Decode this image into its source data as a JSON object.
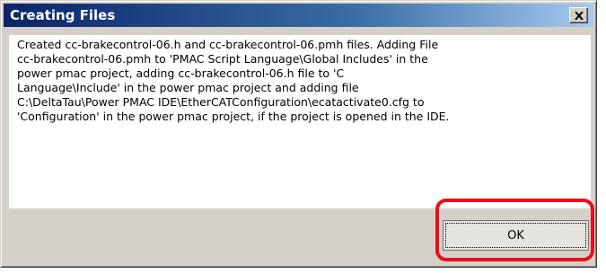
{
  "dialog": {
    "title": "Creating Files",
    "close_label": "X",
    "message_lines": [
      "Created cc-brakecontrol-06.h and cc-brakecontrol-06.pmh files. Adding File",
      "cc-brakecontrol-06.pmh to 'PMAC Script Language\\Global Includes' in the",
      "power pmac project, adding  cc-brakecontrol-06.h file to 'C",
      "Language\\Include' in the power pmac project and adding file",
      "C:\\DeltaTau\\Power PMAC IDE\\EtherCATConfiguration\\ecatactivate0.cfg to",
      "'Configuration' in the power pmac project, if the project is opened in the IDE."
    ],
    "ok_label": "OK"
  },
  "colors": {
    "titlebar_start": "#0a246a",
    "titlebar_end": "#a6caf0",
    "highlight": "#e8101a",
    "dialog_face": "#d4d0c8"
  }
}
